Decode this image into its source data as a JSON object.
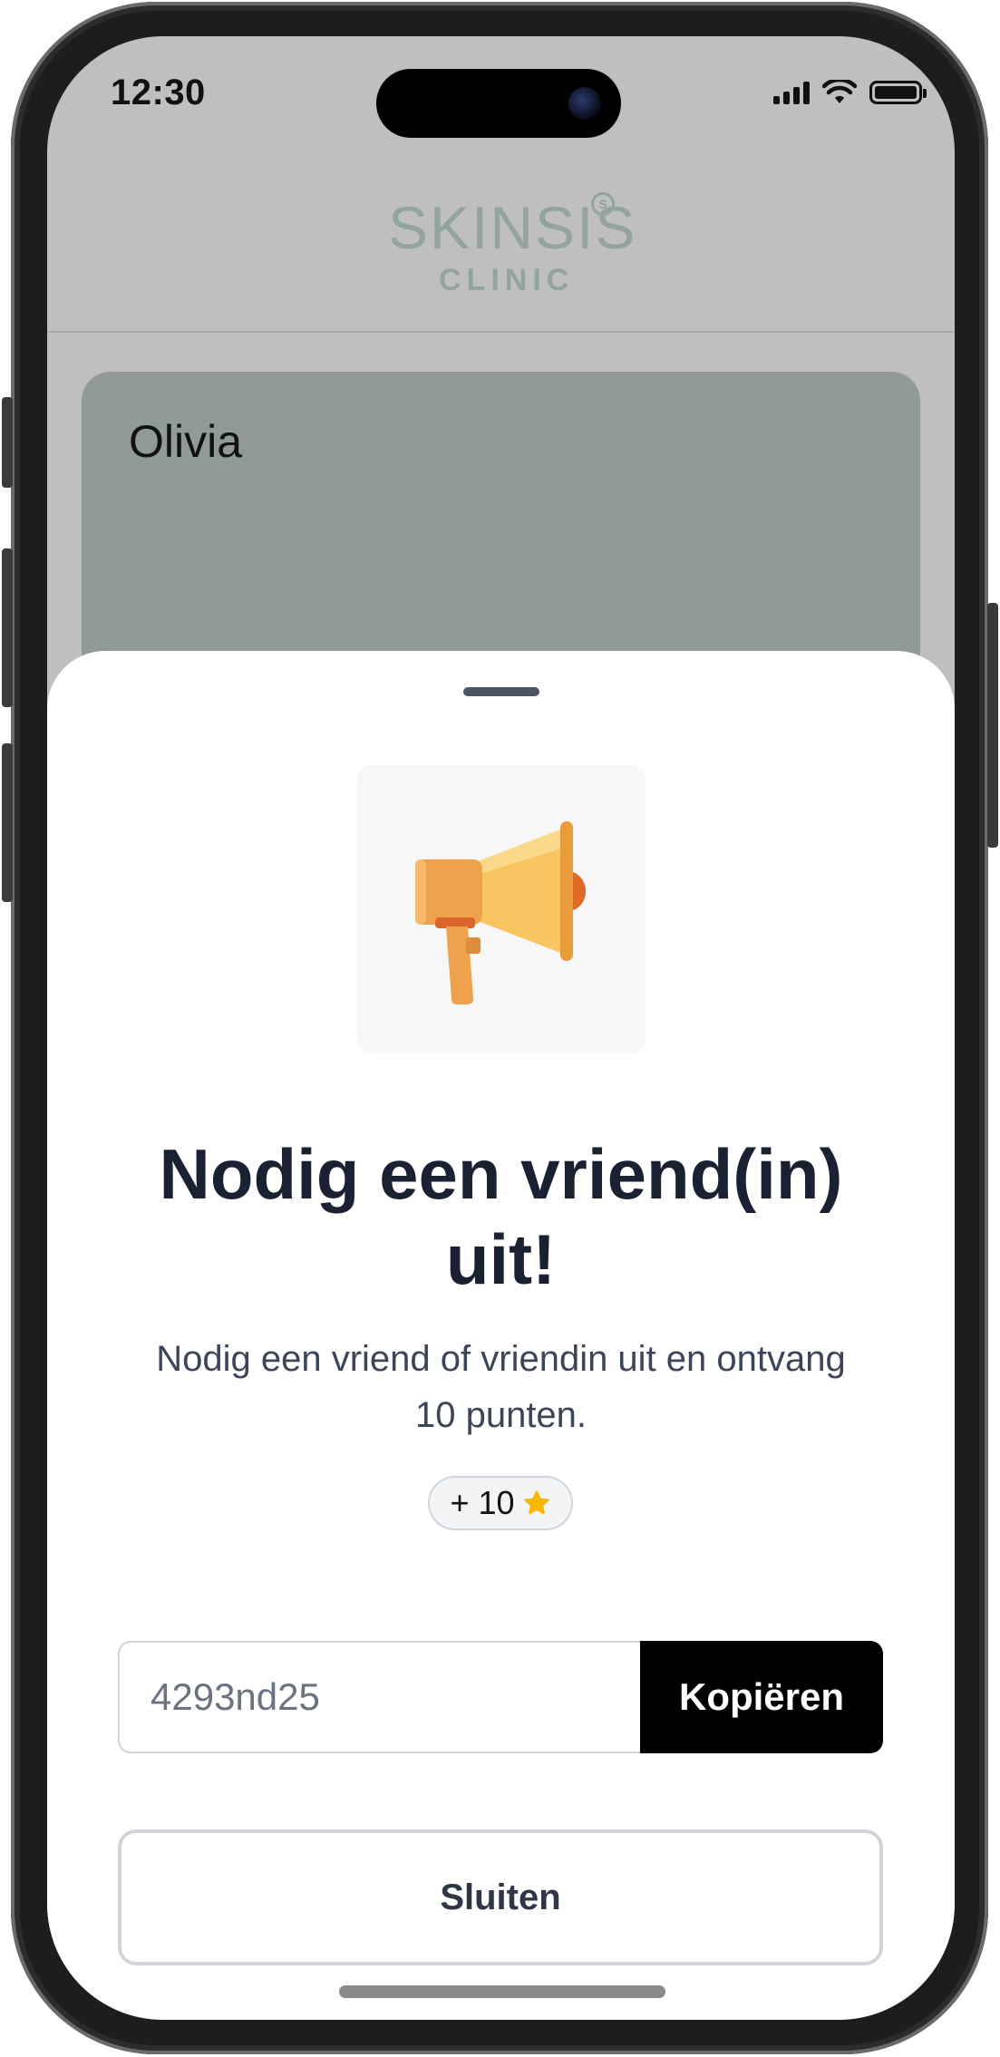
{
  "status_bar": {
    "time": "12:30"
  },
  "brand": {
    "name_light": "SKIN",
    "name_bold": "SIS",
    "subtitle": "CLINIC"
  },
  "profile": {
    "name": "Olivia"
  },
  "invite_sheet": {
    "title": "Nodig een vriend(in) uit!",
    "description": "Nodig een vriend of vriendin uit en ontvang 10 punten.",
    "points_badge": "+ 10",
    "referral_code": "4293nd25",
    "copy_label": "Kopiëren",
    "close_label": "Sluiten",
    "illustration": "megaphone-icon"
  },
  "colors": {
    "brand": "#93a39f",
    "card": "#909a98",
    "title": "#1a2132",
    "copy_button": "#000000",
    "star": "#f5b800"
  }
}
